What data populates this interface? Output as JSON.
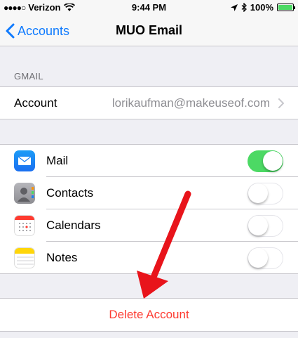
{
  "status_bar": {
    "carrier": "Verizon",
    "time": "9:44 PM",
    "battery": "100%",
    "battery_color": "#4cd964"
  },
  "nav": {
    "back_label": "Accounts",
    "title": "MUO Email"
  },
  "section": {
    "header": "GMAIL"
  },
  "account": {
    "label": "Account",
    "value": "lorikaufman@makeuseof.com"
  },
  "services": [
    {
      "label": "Mail",
      "enabled": true,
      "icon": "mail-icon"
    },
    {
      "label": "Contacts",
      "enabled": false,
      "icon": "contacts-icon"
    },
    {
      "label": "Calendars",
      "enabled": false,
      "icon": "calendars-icon"
    },
    {
      "label": "Notes",
      "enabled": false,
      "icon": "notes-icon"
    }
  ],
  "delete": {
    "label": "Delete Account",
    "color": "#fd3b31"
  },
  "colors": {
    "accent": "#0e7afe",
    "toggle_on": "#4cd964",
    "annotation_arrow": "#e8141b"
  }
}
